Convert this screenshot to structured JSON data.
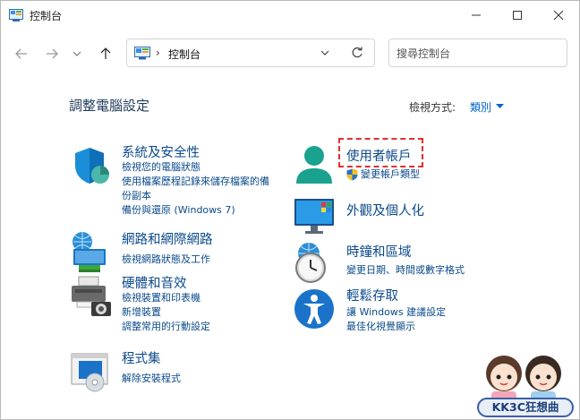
{
  "window": {
    "title": "控制台"
  },
  "nav": {
    "address_text": "控制台",
    "address_sep": "›",
    "search_placeholder": "搜尋控制台"
  },
  "main": {
    "title": "調整電腦設定",
    "view_by_label": "檢視方式:",
    "view_by_value": "類別"
  },
  "categories": [
    {
      "title": "系統及安全性",
      "links": [
        "檢視您的電腦狀態",
        "使用檔案歷程記錄來儲存檔案的備",
        "份副本",
        "備份與還原 (Windows 7)"
      ]
    },
    {
      "title": "網路和網際網路",
      "links": [
        "檢視網路狀態及工作"
      ]
    },
    {
      "title": "硬體和音效",
      "links": [
        "檢視裝置和印表機",
        "新增裝置",
        "調整常用的行動設定"
      ]
    },
    {
      "title": "程式集",
      "links": [
        "解除安裝程式"
      ]
    },
    {
      "title": "使用者帳戶",
      "links": [
        "變更帳戶類型"
      ]
    },
    {
      "title": "外觀及個人化",
      "links": []
    },
    {
      "title": "時鐘和區域",
      "links": [
        "變更日期、時間或數字格式"
      ]
    },
    {
      "title": "輕鬆存取",
      "links": [
        "讓 Windows 建議設定",
        "最佳化視覺顯示"
      ]
    }
  ],
  "watermark": {
    "text": "KK3C狂想曲"
  },
  "colors": {
    "link": "#0b4a8b",
    "highlight_border": "#e03030",
    "accent": "#0066cc"
  }
}
